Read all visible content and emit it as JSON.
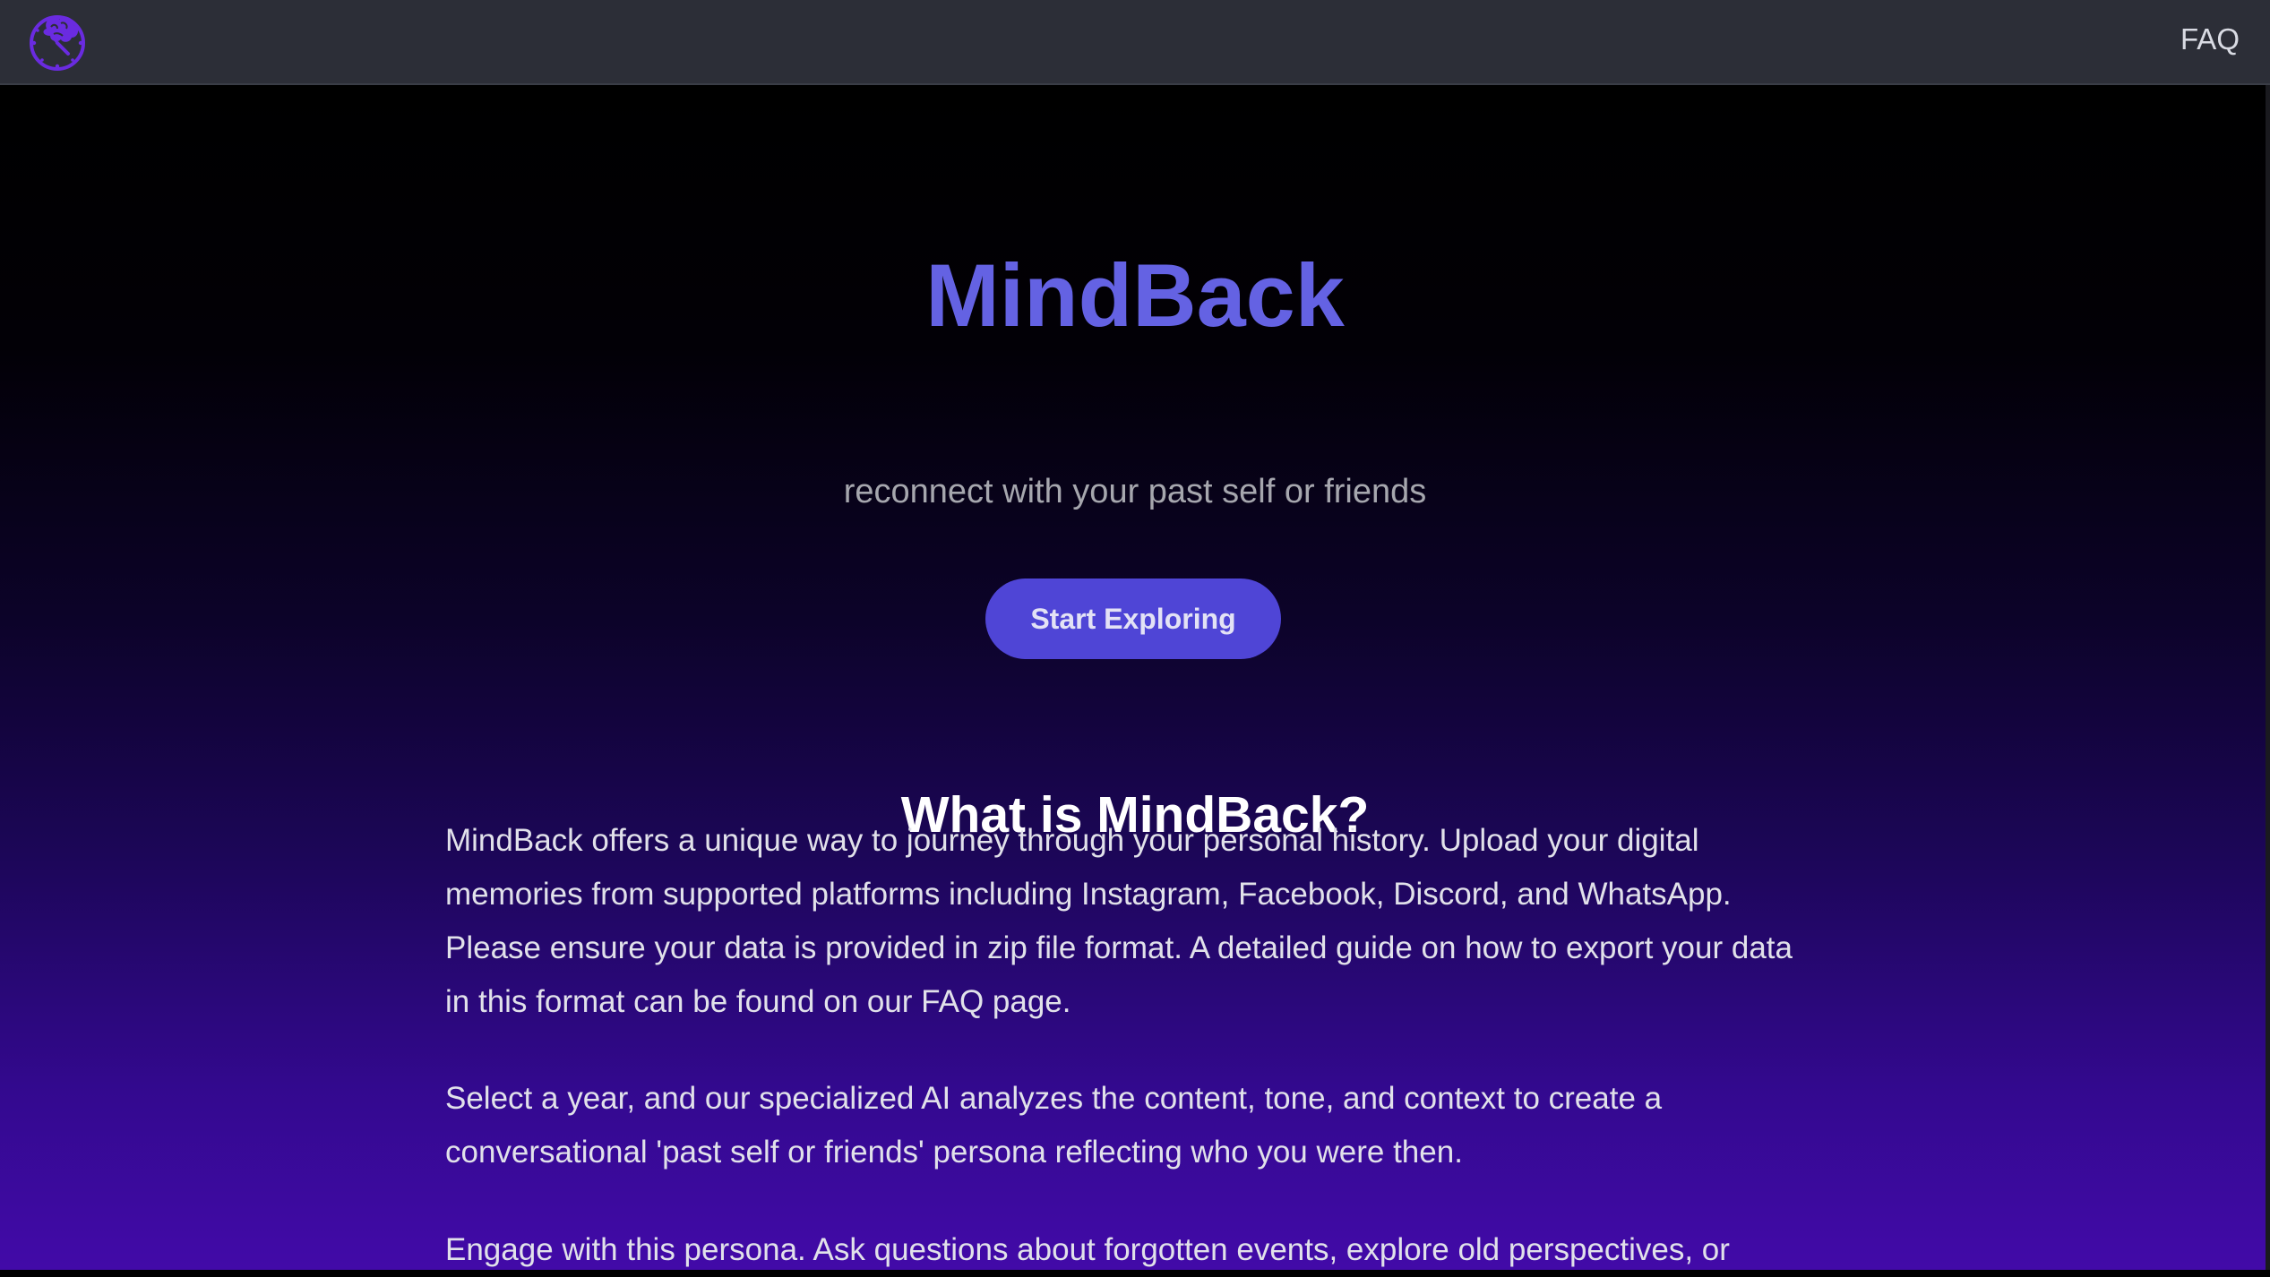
{
  "nav": {
    "logo_icon": "brain-clock-icon",
    "faq_label": "FAQ"
  },
  "hero": {
    "title": "MindBack",
    "subtitle": "reconnect with your past self or friends",
    "cta_label": "Start Exploring"
  },
  "about": {
    "heading": "What is MindBack?",
    "paragraphs": [
      "MindBack offers a unique way to journey through your personal history. Upload your digital memories from supported platforms including Instagram, Facebook, Discord, and WhatsApp. Please ensure your data is provided in zip file format. A detailed guide on how to export your data in this format can be found on our FAQ page.",
      "Select a year, and our specialized AI analyzes the content, tone, and context to create a conversational 'past self or friends' persona reflecting who you were then.",
      "Engage with this persona. Ask questions about forgotten events, explore old perspectives, or"
    ]
  },
  "colors": {
    "accent": "#6462e3",
    "button": "#4f45d6",
    "navbar": "#2c2e37",
    "logo": "#6a2be0"
  }
}
